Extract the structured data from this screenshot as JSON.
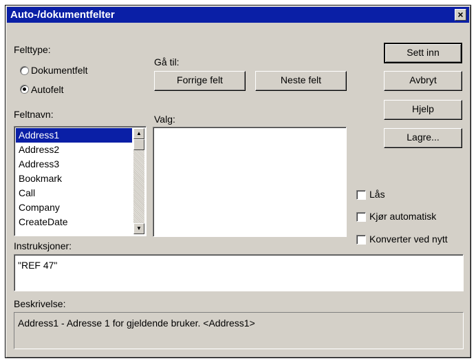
{
  "window": {
    "title": "Auto-/dokumentfelter",
    "close_glyph": "×"
  },
  "field_type": {
    "label": "Felttype:",
    "options": [
      {
        "label": "Dokumentfelt",
        "selected": false
      },
      {
        "label": "Autofelt",
        "selected": true
      }
    ]
  },
  "goto": {
    "label": "Gå til:",
    "prev": "Forrige felt",
    "next": "Neste felt"
  },
  "buttons": {
    "insert": "Sett inn",
    "cancel": "Avbryt",
    "help": "Hjelp",
    "save": "Lagre..."
  },
  "field_names": {
    "label": "Feltnavn:",
    "items": [
      "Address1",
      "Address2",
      "Address3",
      "Bookmark",
      "Call",
      "Company",
      "CreateDate"
    ],
    "selected_index": 0
  },
  "choices": {
    "label": "Valg:"
  },
  "options": {
    "lock": "Lås",
    "auto_run": "Kjør automatisk",
    "convert": "Konverter ved nytt"
  },
  "instructions": {
    "label": "Instruksjoner:",
    "value": "\"REF 47\""
  },
  "description": {
    "label": "Beskrivelse:",
    "value": "Address1 - Adresse 1 for gjeldende bruker. <Address1>"
  },
  "icons": {
    "close": "close-icon",
    "scroll_up": "arrow-up-icon",
    "scroll_down": "arrow-down-icon"
  },
  "colors": {
    "titlebar": "#0a1fa6",
    "face": "#d4d0c8",
    "selection": "#0a1fa6"
  }
}
